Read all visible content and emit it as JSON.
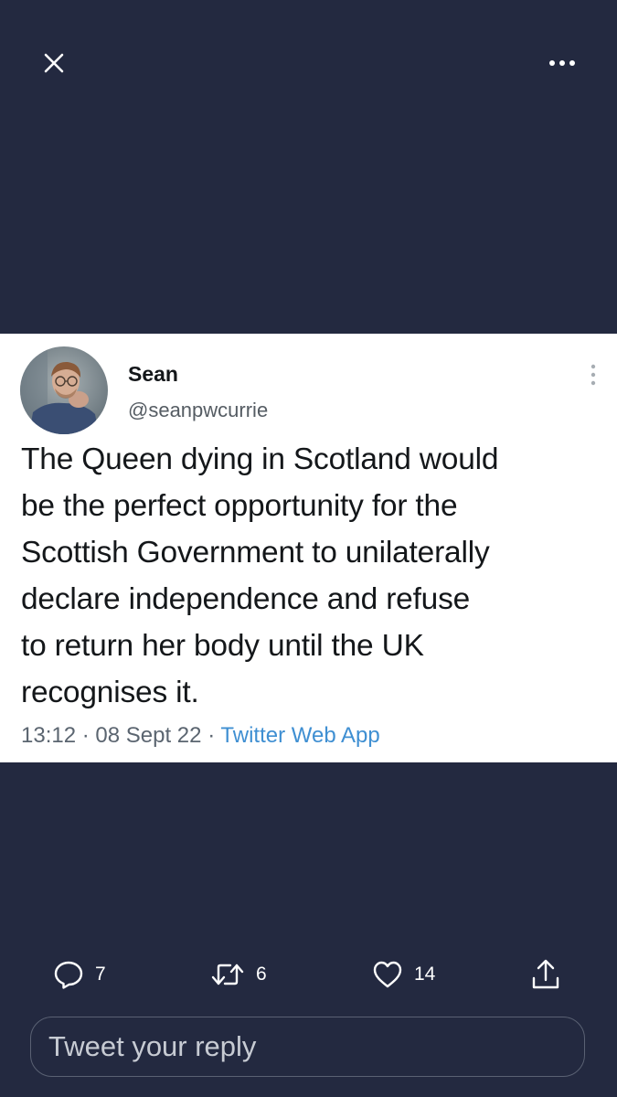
{
  "header": {
    "close_icon": "close-icon",
    "more_icon": "more-horizontal-icon"
  },
  "tweet": {
    "author_name": "Sean",
    "author_handle": "@seanpwcurrie",
    "text": "The Queen dying in Scotland would\nbe the perfect opportunity for the\nScottish Government to unilaterally\ndeclare independence and refuse\nto return her body until the UK\nrecognises it.",
    "time": "13:12",
    "date": "08 Sept 22",
    "separator": "·",
    "source": "Twitter Web App",
    "more_icon": "more-vertical-icon"
  },
  "actions": {
    "replies": "7",
    "retweets": "6",
    "likes": "14"
  },
  "reply": {
    "placeholder": "Tweet your reply"
  },
  "colors": {
    "background": "#232940",
    "card": "#ffffff",
    "link": "#3f8fd2"
  }
}
